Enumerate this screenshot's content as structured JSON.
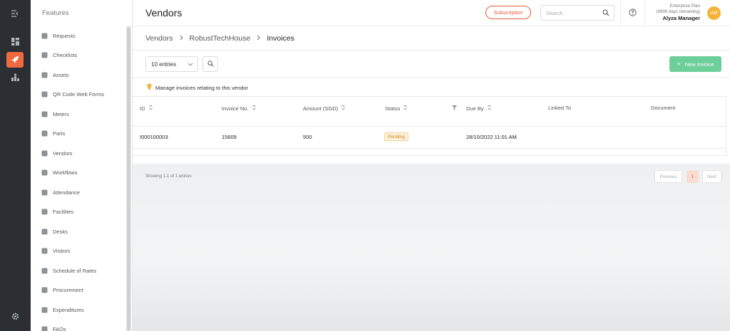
{
  "rail": {
    "items": [
      {
        "name": "collapse-icon"
      },
      {
        "name": "dashboard-icon"
      },
      {
        "name": "rocket-icon",
        "active": true
      },
      {
        "name": "analytics-icon"
      },
      {
        "name": "settings-icon"
      }
    ],
    "accent": "#ef6a3e",
    "bg": "#2b2f33"
  },
  "sidebar": {
    "title": "Features",
    "items": [
      {
        "label": "Requests",
        "icon": "request-icon"
      },
      {
        "label": "Checklists",
        "icon": "checklist-icon"
      },
      {
        "label": "Assets",
        "icon": "asset-icon"
      },
      {
        "label": "QR Code Web Forms",
        "icon": "qr-code-icon"
      },
      {
        "label": "Meters",
        "icon": "meter-icon"
      },
      {
        "label": "Parts",
        "icon": "puzzle-icon"
      },
      {
        "label": "Vendors",
        "icon": "vendor-icon"
      },
      {
        "label": "Workflows",
        "icon": "workflow-icon"
      },
      {
        "label": "Attendance",
        "icon": "attendance-icon"
      },
      {
        "label": "Facilities",
        "icon": "facility-icon"
      },
      {
        "label": "Desks",
        "icon": "desk-icon"
      },
      {
        "label": "Visitors",
        "icon": "visitor-icon"
      },
      {
        "label": "Schedule of Rates",
        "icon": "dollar-icon"
      },
      {
        "label": "Procurement",
        "icon": "procurement-icon"
      },
      {
        "label": "Expenditures",
        "icon": "expenditure-icon"
      },
      {
        "label": "FAQs",
        "icon": "faq-icon"
      }
    ]
  },
  "header": {
    "title": "Vendors",
    "subscription_label": "Subscription",
    "search_placeholder": "Search",
    "plan_line1": "Enterprise Plan",
    "plan_line2": "(9999 days remaining)",
    "user_name": "Alyza Manager",
    "avatar_initials": "AM",
    "brand_color": "#e25b3a"
  },
  "breadcrumb": {
    "items": [
      "Vendors",
      "RobustTechHouse",
      "Invoices"
    ]
  },
  "toolbar": {
    "entries_label": "10 entries",
    "new_invoice_label": "New Invoice",
    "new_invoice_color": "#6dcf9a"
  },
  "info_text": "Manage invoices relating to this vendor",
  "table": {
    "columns": [
      "ID",
      "Invoice No.",
      "Amount (SGD)",
      "Status",
      "Due By",
      "Linked To",
      "Document"
    ],
    "rows": [
      {
        "id": "I000100003",
        "invoice_no": "15609",
        "amount": "500",
        "status": "Pending",
        "due_by": "28/10/2022 11:01 AM",
        "linked_to": "",
        "document": ""
      }
    ]
  },
  "pagination": {
    "showing": "Showing 1-1 of 1 entries",
    "previous": "Previous",
    "current": "1",
    "next": "Next"
  }
}
